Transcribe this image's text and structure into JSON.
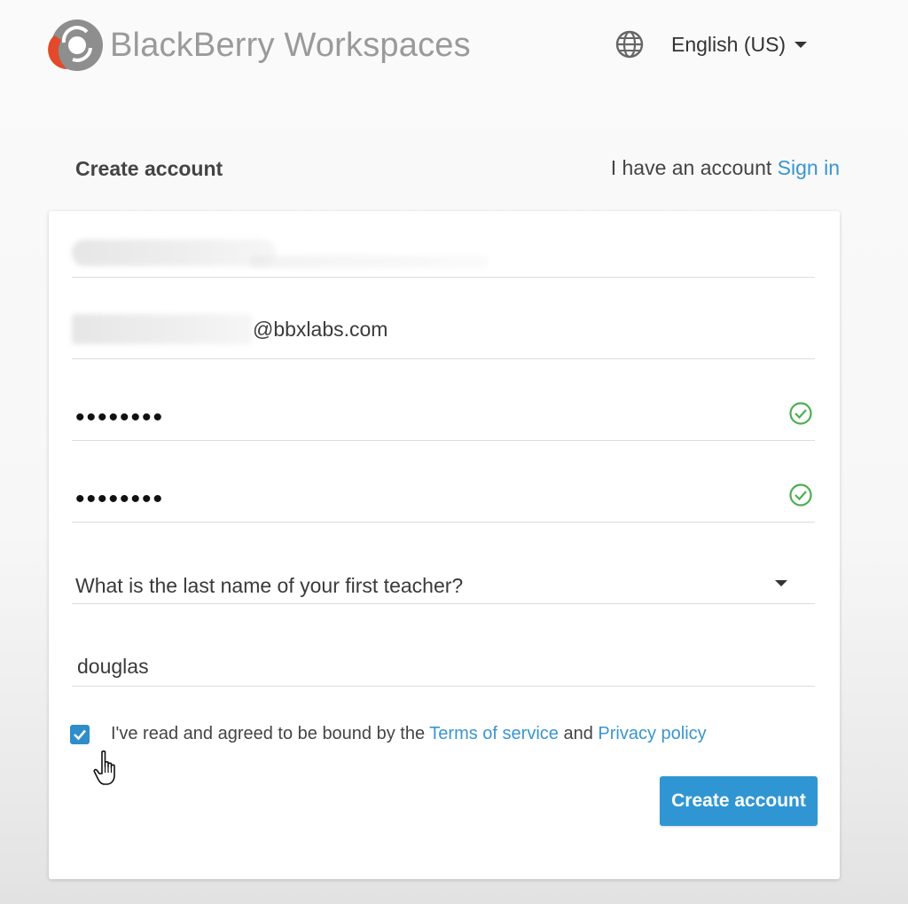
{
  "header": {
    "brand_name": "BlackBerry Workspaces",
    "logo_icon": "blackberry-workspaces-logo",
    "language_icon": "globe-icon",
    "language_label": "English (US)",
    "language_caret_icon": "caret-down-icon"
  },
  "form_header": {
    "title": "Create account",
    "have_account_text": "I have an account",
    "sign_in_label": "Sign in"
  },
  "form": {
    "name_value": "",
    "email_domain": "@bbxlabs.com",
    "password_value": "••••••••",
    "password_valid_icon": "check-circle-icon",
    "confirm_password_value": "••••••••",
    "confirm_valid_icon": "check-circle-icon",
    "security_question": "What is the last name of your first teacher?",
    "security_answer": "douglas",
    "agree_checked": true,
    "agree_prefix": "I've read and agreed to be bound by the",
    "terms_label": "Terms of service",
    "agree_and": "and",
    "privacy_label": "Privacy policy",
    "submit_label": "Create account"
  },
  "colors": {
    "accent": "#2f96d3",
    "link": "#3a95cf",
    "valid": "#4caf50",
    "logo_red": "#e24a2a",
    "logo_gray": "#8e8e8e"
  }
}
